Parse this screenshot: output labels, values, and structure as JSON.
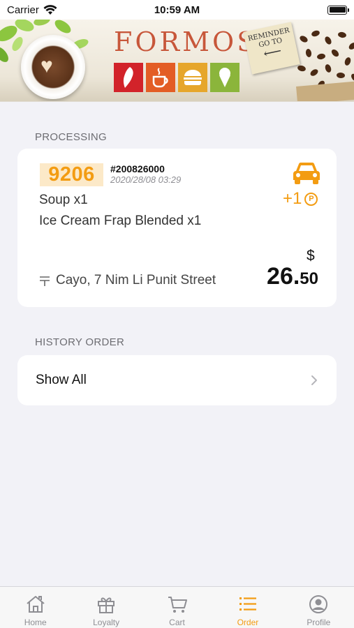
{
  "status_bar": {
    "carrier": "Carrier",
    "time": "10:59 AM"
  },
  "banner": {
    "brand": "FORMOSA",
    "note_text": "REMINDER GO TO"
  },
  "processing": {
    "section_label": "PROCESSING",
    "order": {
      "number": "9206",
      "order_id": "#200826000",
      "datetime": "2020/28/08 03:29",
      "items": [
        {
          "text": "Soup  x1"
        },
        {
          "text": "Ice Cream Frap Blended  x1"
        }
      ],
      "points": "+1",
      "points_badge": "P",
      "address": "Cayo,  7 Nim Li Punit Street",
      "currency": "$",
      "price_integer": "26.",
      "price_decimal": "50"
    }
  },
  "history": {
    "section_label": "HISTORY ORDER",
    "show_all": "Show All"
  },
  "tab_bar": {
    "tabs": [
      {
        "label": "Home",
        "icon": "home-icon"
      },
      {
        "label": "Loyalty",
        "icon": "gift-icon"
      },
      {
        "label": "Cart",
        "icon": "cart-icon"
      },
      {
        "label": "Order",
        "icon": "list-icon",
        "active": true
      },
      {
        "label": "Profile",
        "icon": "profile-icon"
      }
    ]
  },
  "colors": {
    "accent": "#f39c12",
    "background": "#f2f2f7",
    "inactive_tab": "#8e8e93"
  }
}
